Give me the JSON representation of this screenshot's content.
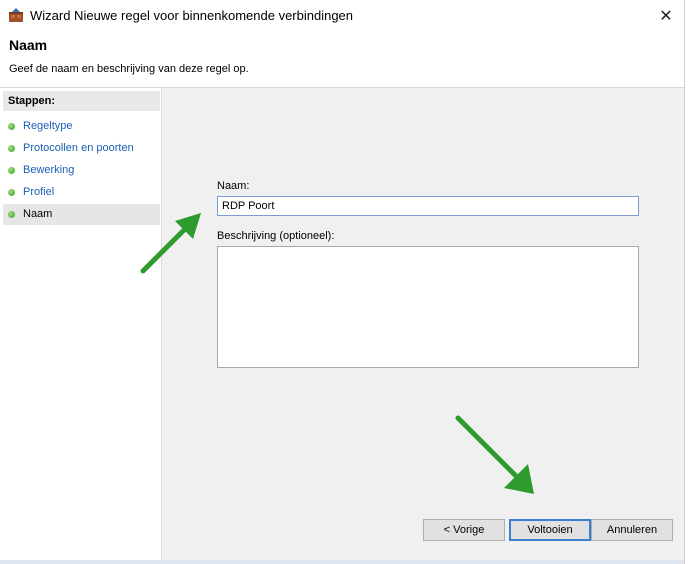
{
  "window": {
    "title": "Wizard Nieuwe regel voor binnenkomende verbindingen",
    "close_glyph": "✕"
  },
  "header": {
    "title": "Naam",
    "description": "Geef de naam en beschrijving van deze regel op."
  },
  "steps": {
    "heading": "Stappen:",
    "items": [
      {
        "label": "Regeltype",
        "active": false
      },
      {
        "label": "Protocollen en poorten",
        "active": false
      },
      {
        "label": "Bewerking",
        "active": false
      },
      {
        "label": "Profiel",
        "active": false
      },
      {
        "label": "Naam",
        "active": true
      }
    ]
  },
  "form": {
    "name_label": "Naam:",
    "name_value": "RDP Poort",
    "description_label": "Beschrijving (optioneel):",
    "description_value": ""
  },
  "buttons": {
    "back": "< Vorige",
    "finish": "Voltooien",
    "cancel": "Annuleren"
  },
  "colors": {
    "accent_arrow": "#2e9b2e",
    "link_text": "#1a5fb4",
    "step_dot": "#3a9a2a"
  },
  "icons": {
    "app": "firewall-wizard-icon",
    "close": "close-icon",
    "step_bullet": "green-dot-icon",
    "annotation": "green-arrow-icon"
  }
}
